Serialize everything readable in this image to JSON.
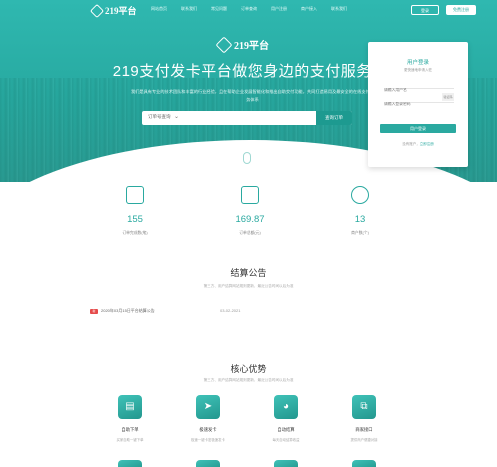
{
  "nav": {
    "logo": "219平台",
    "links": [
      "网站首页",
      "联系我们",
      "常见问题",
      "订单查询",
      "用户注册",
      "商户接入",
      "联系我们"
    ],
    "login_label": "登录",
    "register_label": "免费注册"
  },
  "hero": {
    "logo": "219平台",
    "title": "219支付发卡平台做您身边的支付服务商",
    "description": "我们是具有专业的技术团队和丰富的行业经验，且在帮助企业发展智能化和推出自助交付功能，共同打造易用及最安全的在线支付服务体系",
    "search_select": "订单号查询",
    "search_button": "查询订单"
  },
  "login": {
    "title": "用户登录",
    "subtitle": "更快速地申请入驻",
    "username_placeholder": "请输入用户名",
    "password_placeholder": "请输入登录密码",
    "captcha": "验证码",
    "submit": "用户登录",
    "links_prefix": "没有账户，",
    "links_register": "立即注册"
  },
  "stats": [
    {
      "icon": "check-document-icon",
      "value": "155",
      "label": "订单完成数(笔)"
    },
    {
      "icon": "yen-money-icon",
      "value": "169.87",
      "label": "订单总额(元)"
    },
    {
      "icon": "users-icon",
      "value": "13",
      "label": "商户数(个)"
    }
  ],
  "announcement": {
    "title": "结算公告",
    "subtitle": "第三方、用户结算网站规则更新，最近公告时间以后为准",
    "tag": "新",
    "item_title": "2020年03月15日平台结算公告",
    "item_date": "03-02-2021"
  },
  "advantages": {
    "title": "核心优势",
    "subtitle": "第三方、用户结算网站规则更新，最近公告时间以后为准",
    "items": [
      {
        "icon": "document-icon",
        "name": "自助下单",
        "desc": "买家自助一键下单"
      },
      {
        "icon": "send-icon",
        "name": "极速发卡",
        "desc": "极速一键卡密极速发卡"
      },
      {
        "icon": "gauge-icon",
        "name": "自动结算",
        "desc": "每天自动结算收益"
      },
      {
        "icon": "copy-icon",
        "name": "商家接口",
        "desc": "提供商户便捷对接"
      }
    ]
  },
  "colors": {
    "accent": "#2aa9a0",
    "notice_tag": "#e54b4b"
  }
}
